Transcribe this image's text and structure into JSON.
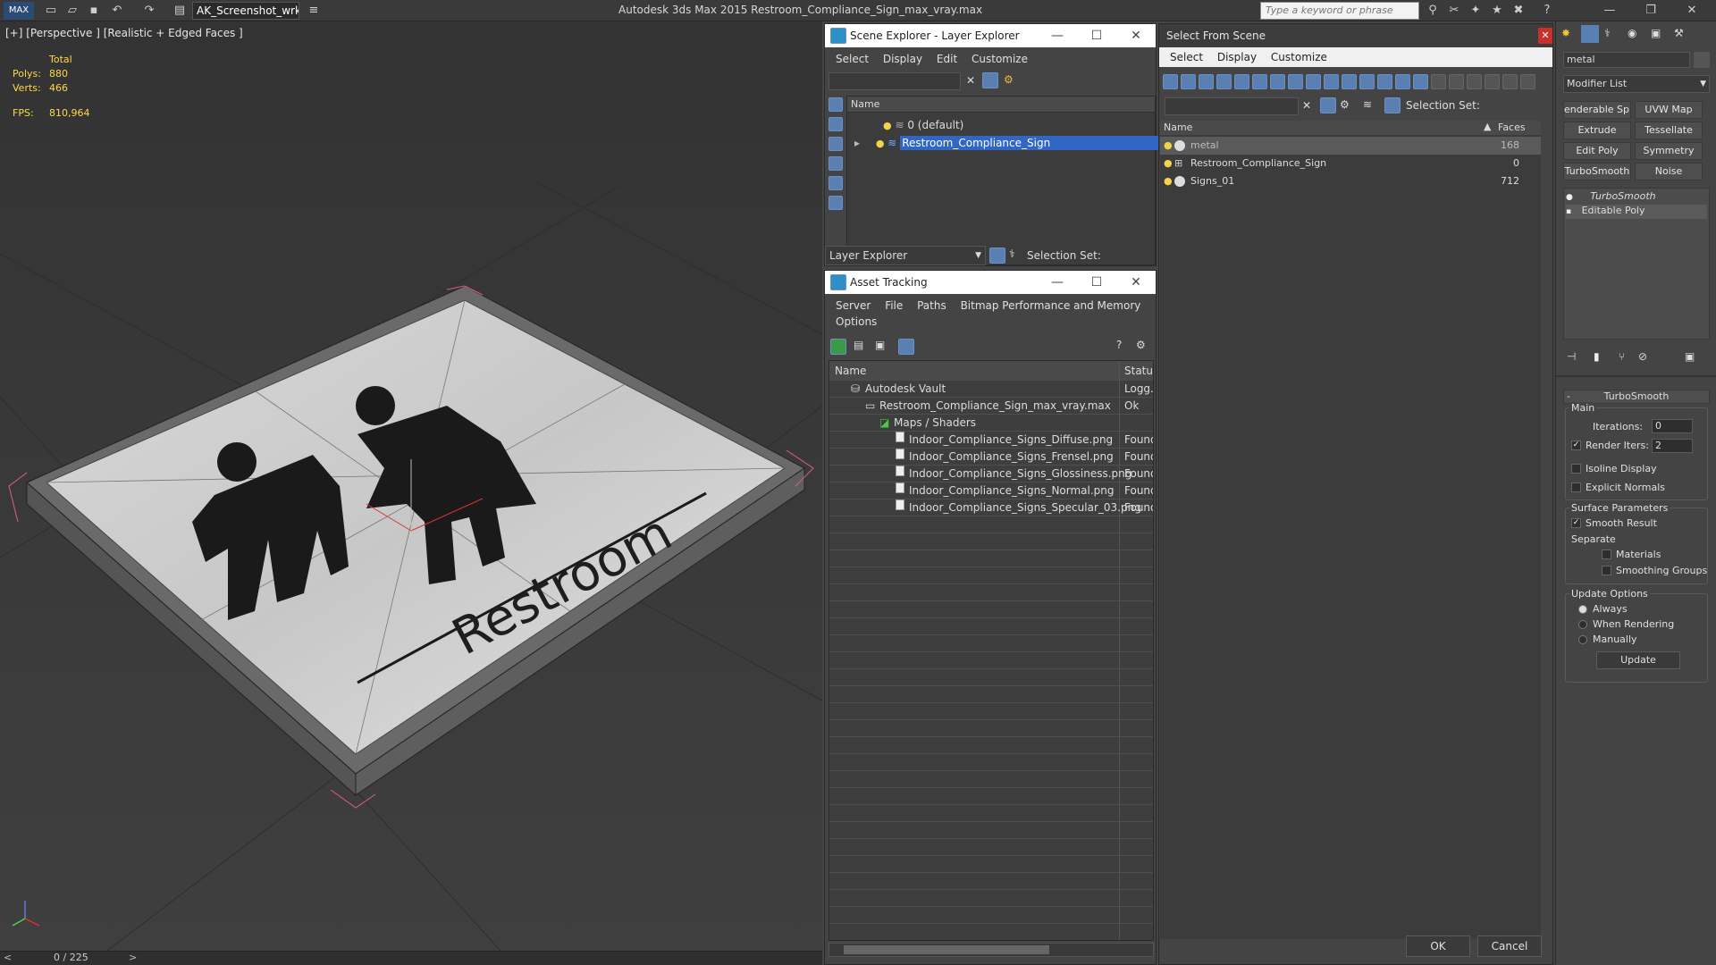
{
  "app": {
    "title": "Autodesk 3ds Max  2015     Restroom_Compliance_Sign_max_vray.max",
    "workspace": "AK_Screenshot_wrksp",
    "search_placeholder": "Type a keyword or phrase"
  },
  "viewport": {
    "label": "[+] [Perspective ] [Realistic + Edged Faces ]",
    "stats_header": "Total",
    "polys_label": "Polys:",
    "polys_value": "880",
    "verts_label": "Verts:",
    "verts_value": "466",
    "fps_label": "FPS:",
    "fps_value": "810,964",
    "sign_text": "Restroom",
    "frame_counter": "0 / 225",
    "prev_btn": "<",
    "next_btn": ">"
  },
  "layer_explorer": {
    "title": "Scene Explorer - Layer Explorer",
    "menu": [
      "Select",
      "Display",
      "Edit",
      "Customize"
    ],
    "column_name": "Name",
    "layers": [
      "0 (default)",
      "Restroom_Compliance_Sign"
    ],
    "footer_dropdown": "Layer Explorer",
    "selection_set_label": "Selection Set:"
  },
  "asset_tracking": {
    "title": "Asset Tracking",
    "menu": [
      "Server",
      "File",
      "Paths",
      "Bitmap Performance and Memory",
      "Options"
    ],
    "col_name": "Name",
    "col_status": "Status",
    "rows": [
      {
        "name": "Autodesk Vault",
        "status": "Logg..."
      },
      {
        "name": "Restroom_Compliance_Sign_max_vray.max",
        "status": "Ok"
      },
      {
        "name": "Maps / Shaders",
        "status": ""
      },
      {
        "name": "Indoor_Compliance_Signs_Diffuse.png",
        "status": "Found"
      },
      {
        "name": "Indoor_Compliance_Signs_Frensel.png",
        "status": "Found"
      },
      {
        "name": "Indoor_Compliance_Signs_Glossiness.png",
        "status": "Found"
      },
      {
        "name": "Indoor_Compliance_Signs_Normal.png",
        "status": "Found"
      },
      {
        "name": "Indoor_Compliance_Signs_Specular_03.png",
        "status": "Found"
      }
    ]
  },
  "select_from_scene": {
    "title": "Select From Scene",
    "menu": [
      "Select",
      "Display",
      "Customize"
    ],
    "selection_set_label": "Selection Set:",
    "col_name": "Name",
    "col_faces": "Faces",
    "objects": [
      {
        "name": "metal",
        "faces": "168"
      },
      {
        "name": "Restroom_Compliance_Sign",
        "faces": "0"
      },
      {
        "name": "Signs_01",
        "faces": "712"
      }
    ],
    "ok_label": "OK",
    "cancel_label": "Cancel"
  },
  "command_panel": {
    "object_name": "metal",
    "modifier_list": "Modifier List",
    "modifier_buttons": [
      "enderable Splin",
      "UVW Map",
      "Extrude",
      "Tessellate",
      "Edit Poly",
      "Symmetry",
      "TurboSmooth",
      "Noise"
    ],
    "stack": [
      "TurboSmooth",
      "Editable Poly"
    ],
    "rollout_title": "TurboSmooth",
    "main_label": "Main",
    "iterations_label": "Iterations:",
    "iterations_value": "0",
    "render_iters_label": "Render Iters:",
    "render_iters_value": "2",
    "isoline_label": "Isoline Display",
    "explicit_normals_label": "Explicit Normals",
    "surface_params_label": "Surface Parameters",
    "smooth_result_label": "Smooth Result",
    "separate_label": "Separate",
    "materials_label": "Materials",
    "smoothing_groups_label": "Smoothing Groups",
    "update_options_label": "Update Options",
    "always_label": "Always",
    "when_rendering_label": "When Rendering",
    "manually_label": "Manually",
    "update_button": "Update",
    "minus_sign": "-"
  }
}
